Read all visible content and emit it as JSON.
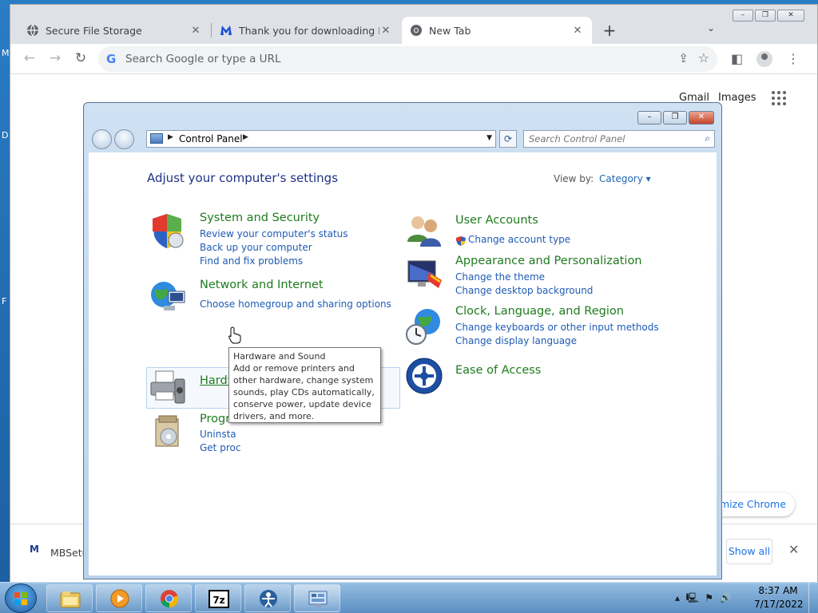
{
  "desktop": {
    "letters": [
      "M",
      "D",
      "F"
    ]
  },
  "browser": {
    "tabs": [
      {
        "label": "Secure File Storage",
        "icon": "globe-icon",
        "active": false
      },
      {
        "label": "Thank you for downloading Malw",
        "icon": "malwarebytes-icon",
        "active": false
      },
      {
        "label": "New Tab",
        "icon": "chrome-icon",
        "active": true
      }
    ],
    "omnibox_placeholder": "Search Google or type a URL",
    "gmail": "Gmail",
    "images": "Images",
    "customize_chrome": "mize Chrome",
    "download": {
      "filename": "MBSetu",
      "show_all": "Show all"
    },
    "window_controls": [
      "–",
      "❐",
      "✕"
    ]
  },
  "control_panel": {
    "address": "Control Panel",
    "search_placeholder": "Search Control Panel",
    "heading": "Adjust your computer's settings",
    "view_by_label": "View by:",
    "view_by_value": "Category",
    "left_categories": [
      {
        "title": "System and Security",
        "icon": "shield-icon",
        "links": [
          "Review your computer's status",
          "Back up your computer",
          "Find and fix problems"
        ]
      },
      {
        "title": "Network and Internet",
        "icon": "network-globe-icon",
        "links": [
          "Choose homegroup and sharing options"
        ]
      },
      {
        "title": "Hardware and Sound",
        "icon": "printer-icon",
        "links": []
      },
      {
        "title": "Progra",
        "icon": "programs-icon",
        "links": [
          "Uninsta",
          "Get proc"
        ]
      }
    ],
    "right_categories": [
      {
        "title": "User Accounts",
        "icon": "users-icon",
        "links": [
          "Change account type"
        ]
      },
      {
        "title": "Appearance and Personalization",
        "icon": "monitor-paint-icon",
        "links": [
          "Change the theme",
          "Change desktop background"
        ]
      },
      {
        "title": "Clock, Language, and Region",
        "icon": "clock-globe-icon",
        "links": [
          "Change keyboards or other input methods",
          "Change display language"
        ]
      },
      {
        "title": "Ease of Access",
        "icon": "ease-of-access-icon",
        "links": []
      }
    ],
    "tooltip": {
      "title": "Hardware and Sound",
      "body": "Add or remove printers and other hardware, change system sounds, play CDs automatically, conserve power, update device drivers, and more."
    }
  },
  "taskbar": {
    "apps": [
      "explorer-icon",
      "media-player-icon",
      "chrome-icon",
      "7zip-icon",
      "people-icon",
      "control-panel-icon"
    ],
    "time": "8:37 AM",
    "date": "7/17/2022"
  },
  "colors": {
    "link": "#1e5bb5",
    "category_title": "#1e7b1e",
    "heading": "#1e3287",
    "chrome_accent": "#1a73e8"
  }
}
